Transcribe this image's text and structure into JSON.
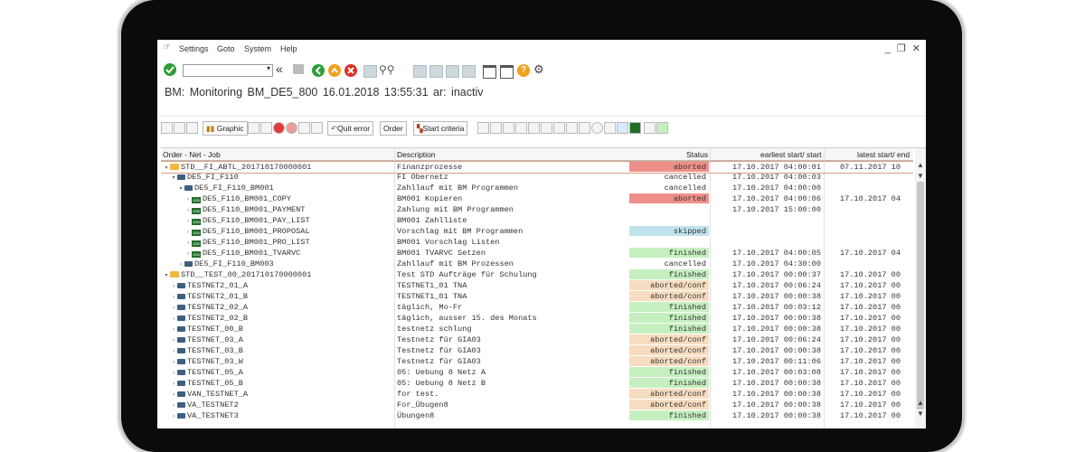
{
  "menu": {
    "items": [
      "Settings",
      "Goto",
      "System",
      "Help"
    ],
    "window_controls": "_ ❐ ✕"
  },
  "toolbar": {
    "command_field": "",
    "icons": [
      "check-icon",
      "back-icon",
      "save-icon",
      "exit-icon",
      "cancel-icon",
      "print-icon",
      "find-icon",
      "find-next-icon",
      "first-page-icon",
      "prev-page-icon",
      "next-page-icon",
      "last-page-icon",
      "new-session-icon",
      "shortcut-icon",
      "help-icon",
      "customize-icon"
    ]
  },
  "header": {
    "title": "BM: Monitoring   BM_DE5_800   16.01.2018   13:55:31   ar: inactiv"
  },
  "app_toolbar": {
    "graphic": "Graphic",
    "quit_error": "Quit error",
    "order": "Order",
    "start_criteria": "Start criteria"
  },
  "table": {
    "columns": [
      "Order - Net - Job",
      "Description",
      "Status",
      "earliest start/ start",
      "latest start/ end"
    ],
    "rows": [
      {
        "type": "folder",
        "indent": 0,
        "expanded": true,
        "name": "STD__FI_ABTL_201710170000001",
        "desc": "Finanzprozesse",
        "status": "aborted",
        "status_color": "#ef8f8a",
        "earliest": "17.10.2017 04:00:01",
        "latest": "07.11.2017 10"
      },
      {
        "type": "net",
        "indent": 1,
        "expanded": true,
        "name": "DE5_FI_F110",
        "desc": "FI Obernetz",
        "status": "cancelled",
        "status_color": "",
        "earliest": "17.10.2017 04:00:03",
        "latest": ""
      },
      {
        "type": "net",
        "indent": 2,
        "expanded": true,
        "name": "DE5_FI_F110_BM001",
        "desc": "Zahllauf mit BM Programmen",
        "status": "cancelled",
        "status_color": "",
        "earliest": "17.10.2017 04:00:00",
        "latest": ""
      },
      {
        "type": "job",
        "indent": 3,
        "expanded": false,
        "name": "DE5_F110_BM001_COPY",
        "desc": "BM001 Kopieren",
        "status": "aborted",
        "status_color": "#ef8f8a",
        "earliest": "17.10.2017 04:00:06",
        "latest": "17.10.2017 04"
      },
      {
        "type": "job",
        "indent": 3,
        "expanded": false,
        "name": "DE5_F110_BM001_PAYMENT",
        "desc": "Zahlung mit BM Programmen",
        "status": "",
        "status_color": "",
        "earliest": "17.10.2017 15:00:00",
        "latest": ""
      },
      {
        "type": "job",
        "indent": 3,
        "expanded": false,
        "name": "DE5_F110_BM001_PAY_LIST",
        "desc": "BM001 Zahlliste",
        "status": "",
        "status_color": "",
        "earliest": "",
        "latest": ""
      },
      {
        "type": "job",
        "indent": 3,
        "expanded": false,
        "name": "DE5_F110_BM001_PROPOSAL",
        "desc": "Vorschlag mit BM Programmen",
        "status": "skipped",
        "status_color": "#bfe3ec",
        "earliest": "",
        "latest": ""
      },
      {
        "type": "job",
        "indent": 3,
        "expanded": false,
        "name": "DE5_F110_BM001_PRO_LIST",
        "desc": "BM001 Vorschlag Listen",
        "status": "",
        "status_color": "",
        "earliest": "",
        "latest": ""
      },
      {
        "type": "job",
        "indent": 3,
        "expanded": false,
        "name": "DE5_F110_BM001_TVARVC",
        "desc": "BM001 TVARVC Setzen",
        "status": "finished",
        "status_color": "#c6efc0",
        "earliest": "17.10.2017 04:00:05",
        "latest": "17.10.2017 04"
      },
      {
        "type": "net",
        "indent": 2,
        "expanded": false,
        "name": "DE5_FI_F110_BM003",
        "desc": "Zahllauf mit BM Prozessen",
        "status": "cancelled",
        "status_color": "",
        "earliest": "17.10.2017 04:30:00",
        "latest": ""
      },
      {
        "type": "folder",
        "indent": 0,
        "expanded": true,
        "name": "STD__TEST_00_201710170000001",
        "desc": "Test STD Aufträge für Schulung",
        "status": "finished",
        "status_color": "#c6efc0",
        "earliest": "17.10.2017 00:00:37",
        "latest": "17.10.2017 00"
      },
      {
        "type": "net",
        "indent": 1,
        "expanded": false,
        "name": "TESTNET2_01_A",
        "desc": "TESTNET1_01 TNA",
        "status": "aborted/conf",
        "status_color": "#f6dcc0",
        "earliest": "17.10.2017 00:06:24",
        "latest": "17.10.2017 00"
      },
      {
        "type": "net",
        "indent": 1,
        "expanded": false,
        "name": "TESTNET2_01_B",
        "desc": "TESTNET1_01 TNA",
        "status": "aborted/conf",
        "status_color": "#f6dcc0",
        "earliest": "17.10.2017 00:00:38",
        "latest": "17.10.2017 00"
      },
      {
        "type": "net",
        "indent": 1,
        "expanded": false,
        "name": "TESTNET2_02_A",
        "desc": "täglich, Mo-Fr",
        "status": "finished",
        "status_color": "#c6efc0",
        "earliest": "17.10.2017 00:03:12",
        "latest": "17.10.2017 00"
      },
      {
        "type": "net",
        "indent": 1,
        "expanded": false,
        "name": "TESTNET2_02_B",
        "desc": "täglich, ausser 15. des Monats",
        "status": "finished",
        "status_color": "#c6efc0",
        "earliest": "17.10.2017 00:00:38",
        "latest": "17.10.2017 00"
      },
      {
        "type": "net",
        "indent": 1,
        "expanded": false,
        "name": "TESTNET_00_B",
        "desc": "testnetz schlung",
        "status": "finished",
        "status_color": "#c6efc0",
        "earliest": "17.10.2017 00:00:38",
        "latest": "17.10.2017 00"
      },
      {
        "type": "net",
        "indent": 1,
        "expanded": false,
        "name": "TESTNET_03_A",
        "desc": "Testnetz für GIA03",
        "status": "aborted/conf",
        "status_color": "#f6dcc0",
        "earliest": "17.10.2017 00:06:24",
        "latest": "17.10.2017 00"
      },
      {
        "type": "net",
        "indent": 1,
        "expanded": false,
        "name": "TESTNET_03_B",
        "desc": "Testnetz für GIA03",
        "status": "aborted/conf",
        "status_color": "#f6dcc0",
        "earliest": "17.10.2017 00:00:38",
        "latest": "17.10.2017 00"
      },
      {
        "type": "net",
        "indent": 1,
        "expanded": false,
        "name": "TESTNET_03_W",
        "desc": "Testnetz für GIA03",
        "status": "aborted/conf",
        "status_color": "#f6dcc0",
        "earliest": "17.10.2017 00:11:06",
        "latest": "17.10.2017 00"
      },
      {
        "type": "net",
        "indent": 1,
        "expanded": false,
        "name": "TESTNET_05_A",
        "desc": "05: Uebung 8 Netz A",
        "status": "finished",
        "status_color": "#c6efc0",
        "earliest": "17.10.2017 00:03:08",
        "latest": "17.10.2017 00"
      },
      {
        "type": "net",
        "indent": 1,
        "expanded": false,
        "name": "TESTNET_05_B",
        "desc": "05: Uebung 8 Netz B",
        "status": "finished",
        "status_color": "#c6efc0",
        "earliest": "17.10.2017 00:00:38",
        "latest": "17.10.2017 00"
      },
      {
        "type": "net",
        "indent": 1,
        "expanded": false,
        "name": "VAN_TESTNET_A",
        "desc": "for test.",
        "status": "aborted/conf",
        "status_color": "#f6dcc0",
        "earliest": "17.10.2017 00:00:38",
        "latest": "17.10.2017 00"
      },
      {
        "type": "net",
        "indent": 1,
        "expanded": false,
        "name": "VA_TESTNET2",
        "desc": "For_Übugen8",
        "status": "aborted/conf",
        "status_color": "#f6dcc0",
        "earliest": "17.10.2017 00:00:38",
        "latest": "17.10.2017 00"
      },
      {
        "type": "net",
        "indent": 1,
        "expanded": false,
        "name": "VA_TESTNET3",
        "desc": "Übungen8",
        "status": "finished",
        "status_color": "#c6efc0",
        "earliest": "17.10.2017 00:00:38",
        "latest": "17.10.2017 00"
      }
    ]
  }
}
